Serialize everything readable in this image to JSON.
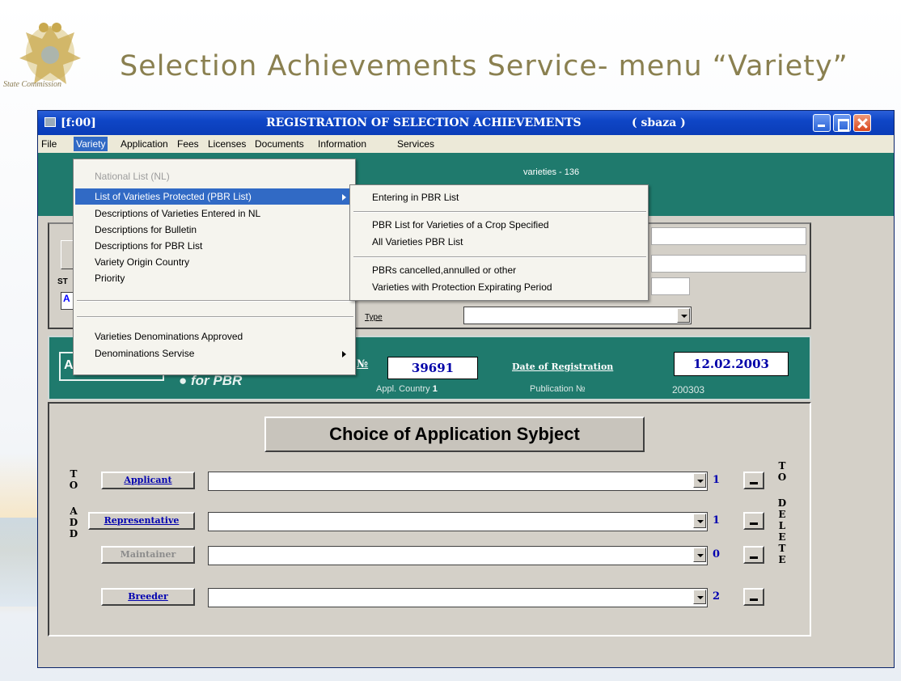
{
  "slide": {
    "title": "Selection Achievements Service- menu “Variety”",
    "emblem_caption": "State Commission"
  },
  "window": {
    "title_left": "[f:00]",
    "title_center": "REGISTRATION OF SELECTION ACHIEVEMENTS",
    "title_user": "( sbaza )"
  },
  "menubar": {
    "items": [
      "File",
      "Variety",
      "Application",
      "Fees",
      "Licenses",
      "Documents",
      "Information",
      "Services"
    ],
    "active": "Variety"
  },
  "header": {
    "varieties_count": "varieties - 136"
  },
  "variety_menu": {
    "items": [
      "National List (NL)",
      "List of Varieties Protected (PBR List)",
      "Descriptions of Varieties Entered  in NL",
      "Descriptions for Bulletin",
      "Descriptions for PBR List",
      "Variety Origin Country",
      "Priority",
      "Varieties Denominations  Approved",
      "Denominations Servise"
    ]
  },
  "pbr_submenu": {
    "items": [
      "Entering in PBR List",
      "PBR List for Varieties of a Crop Specified",
      "All Varieties PBR  List",
      "PBRs cancelled,annulled or other",
      "Varieties with  Protection Expirating Period"
    ]
  },
  "mid_panel": {
    "label_sm": "ST",
    "combo_value": "A",
    "type_label": "Type"
  },
  "application": {
    "left_box": "A",
    "for_label": "for PBR",
    "no_label": "№",
    "number": "39691",
    "appl_country_label": "Appl. Country",
    "appl_country_value": "1",
    "date_label": "Date of Registration",
    "date": "12.02.2003",
    "publication_label": "Publication  №",
    "publication_value": "200303"
  },
  "subject": {
    "heading": "Choice of Application Sybject",
    "to_add": [
      "T",
      "O",
      "",
      "A",
      "D",
      "D"
    ],
    "to_delete": [
      "T",
      "O",
      "",
      "D",
      "E",
      "L",
      "E",
      "T",
      "E"
    ],
    "rows": [
      {
        "label": "Applicant",
        "count": "1",
        "enabled": true
      },
      {
        "label": "Representative",
        "count": "1",
        "enabled": true
      },
      {
        "label": "Maintainer",
        "count": "0",
        "enabled": false
      },
      {
        "label": "Breeder",
        "count": "2",
        "enabled": true
      }
    ]
  },
  "colors": {
    "titlebar": "#0a3cb8",
    "teal": "#1f7a6d",
    "menu_highlight": "#316ac5",
    "link_blue": "#0000b0"
  }
}
